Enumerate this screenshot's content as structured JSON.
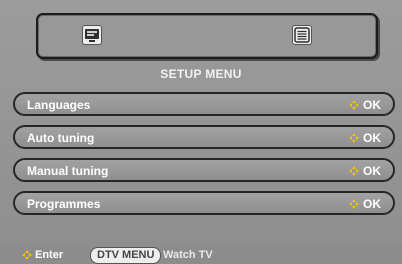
{
  "header": {
    "icons": [
      "tv-icon",
      "teletext-icon"
    ]
  },
  "title": "SETUP MENU",
  "menu": {
    "items": [
      {
        "label": "Languages",
        "ok": "OK"
      },
      {
        "label": "Auto tuning",
        "ok": "OK"
      },
      {
        "label": "Manual tuning",
        "ok": "OK"
      },
      {
        "label": "Programmes",
        "ok": "OK"
      }
    ]
  },
  "footer": {
    "enter_label": "Enter",
    "dtv_menu_label": "DTV MENU",
    "watch_label": "Watch TV"
  },
  "colors": {
    "background": "#959595",
    "text": "#ffffff",
    "border": "#262626",
    "accent": "#f2c200"
  }
}
